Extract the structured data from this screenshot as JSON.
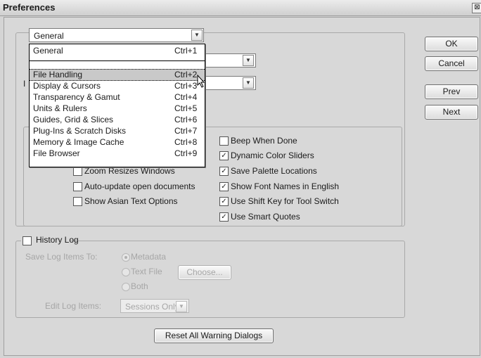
{
  "window": {
    "title": "Preferences",
    "close_glyph": "⊠"
  },
  "section_select": {
    "value": "General"
  },
  "menu": {
    "items": [
      {
        "label": "General",
        "shortcut": "Ctrl+1"
      },
      {
        "label": "File Handling",
        "shortcut": "Ctrl+2"
      },
      {
        "label": "Display & Cursors",
        "shortcut": "Ctrl+3"
      },
      {
        "label": "Transparency & Gamut",
        "shortcut": "Ctrl+4"
      },
      {
        "label": "Units & Rulers",
        "shortcut": "Ctrl+5"
      },
      {
        "label": "Guides, Grid & Slices",
        "shortcut": "Ctrl+6"
      },
      {
        "label": "Plug-Ins & Scratch Disks",
        "shortcut": "Ctrl+7"
      },
      {
        "label": "Memory & Image Cache",
        "shortcut": "Ctrl+8"
      },
      {
        "label": "File Browser",
        "shortcut": "Ctrl+9"
      }
    ],
    "highlighted": "File Handling"
  },
  "buttons": {
    "ok": "OK",
    "cancel": "Cancel",
    "prev": "Prev",
    "next": "Next",
    "reset_warnings": "Reset All Warning Dialogs",
    "choose": "Choose..."
  },
  "options_left": [
    {
      "label": "Zoom Resizes Windows",
      "checked": false
    },
    {
      "label": "Auto-update open documents",
      "checked": false
    },
    {
      "label": "Show Asian Text Options",
      "checked": false
    }
  ],
  "options_right": [
    {
      "label": "Beep When Done",
      "checked": false
    },
    {
      "label": "Dynamic Color Sliders",
      "checked": true
    },
    {
      "label": "Save Palette Locations",
      "checked": true
    },
    {
      "label": "Show Font Names in English",
      "checked": true
    },
    {
      "label": "Use Shift Key for Tool Switch",
      "checked": true
    },
    {
      "label": "Use Smart Quotes",
      "checked": true
    }
  ],
  "history": {
    "label": "History Log",
    "save_to_label": "Save Log Items To:",
    "radio": [
      "Metadata",
      "Text File",
      "Both"
    ],
    "edit_label": "Edit Log Items:",
    "edit_value": "Sessions Only"
  },
  "partial_label": "I",
  "check_glyph": "✓",
  "arrow_glyph": "▼"
}
